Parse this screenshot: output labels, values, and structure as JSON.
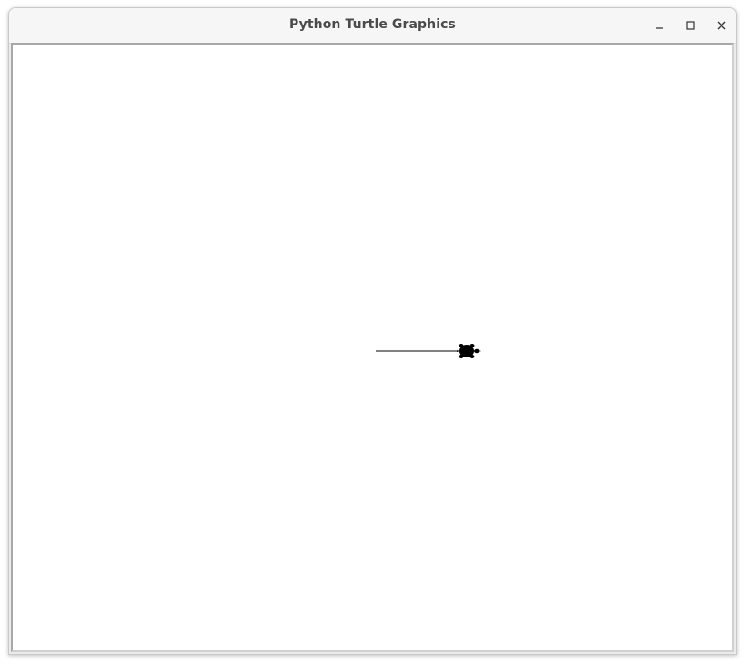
{
  "window": {
    "title": "Python Turtle Graphics"
  },
  "controls": {
    "minimize_icon": "minimize-icon",
    "maximize_icon": "maximize-icon",
    "close_icon": "close-icon"
  },
  "canvas": {
    "background": "#ffffff",
    "pen_color": "#000000",
    "turtle": {
      "shape": "turtle",
      "color": "#000000",
      "heading_degrees": 0
    }
  }
}
